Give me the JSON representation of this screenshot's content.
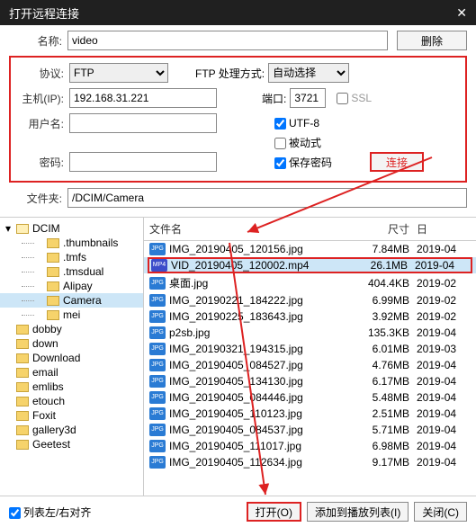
{
  "titlebar": {
    "title": "打开远程连接"
  },
  "form": {
    "name_label": "名称:",
    "name_value": "video",
    "delete_label": "删除",
    "protocol_label": "协议:",
    "protocol_value": "FTP",
    "mode_label": "FTP 处理方式:",
    "mode_value": "自动选择",
    "host_label": "主机(IP):",
    "host_value": "192.168.31.221",
    "port_label": "端口:",
    "port_value": "3721",
    "ssl_label": "SSL",
    "user_label": "用户名:",
    "user_value": "",
    "utf8_label": "UTF-8",
    "utf8_checked": true,
    "passive_label": "被动式",
    "passive_checked": false,
    "pass_label": "密码:",
    "pass_value": "",
    "savepw_label": "保存密码",
    "savepw_checked": true,
    "connect_label": "连接",
    "folder_label": "文件夹:",
    "folder_value": "/DCIM/Camera"
  },
  "tree": [
    {
      "label": "DCIM",
      "depth": 0,
      "open": true
    },
    {
      "label": ".thumbnails",
      "depth": 1
    },
    {
      "label": ".tmfs",
      "depth": 1
    },
    {
      "label": ".tmsdual",
      "depth": 1
    },
    {
      "label": "Alipay",
      "depth": 1
    },
    {
      "label": "Camera",
      "depth": 1,
      "selected": true
    },
    {
      "label": "mei",
      "depth": 1
    },
    {
      "label": "dobby",
      "depth": 0
    },
    {
      "label": "down",
      "depth": 0
    },
    {
      "label": "Download",
      "depth": 0
    },
    {
      "label": "email",
      "depth": 0
    },
    {
      "label": "emlibs",
      "depth": 0
    },
    {
      "label": "etouch",
      "depth": 0
    },
    {
      "label": "Foxit",
      "depth": 0
    },
    {
      "label": "gallery3d",
      "depth": 0
    },
    {
      "label": "Geetest",
      "depth": 0
    }
  ],
  "file_headers": {
    "name": "文件名",
    "size": "尺寸",
    "date": "日"
  },
  "files": [
    {
      "icon": "JPG",
      "name": "IMG_20190405_120156.jpg",
      "size": "7.84MB",
      "date": "2019-04"
    },
    {
      "icon": "MP4",
      "name": "VID_20190405_120002.mp4",
      "size": "26.1MB",
      "date": "2019-04",
      "selected": true,
      "boxed": true
    },
    {
      "icon": "JPG",
      "name": "桌面.jpg",
      "size": "404.4KB",
      "date": "2019-02"
    },
    {
      "icon": "JPG",
      "name": "IMG_20190221_184222.jpg",
      "size": "6.99MB",
      "date": "2019-02"
    },
    {
      "icon": "JPG",
      "name": "IMG_20190225_183643.jpg",
      "size": "3.92MB",
      "date": "2019-02"
    },
    {
      "icon": "JPG",
      "name": "p2sb.jpg",
      "size": "135.3KB",
      "date": "2019-04"
    },
    {
      "icon": "JPG",
      "name": "IMG_20190321_194315.jpg",
      "size": "6.01MB",
      "date": "2019-03"
    },
    {
      "icon": "JPG",
      "name": "IMG_20190405_084527.jpg",
      "size": "4.76MB",
      "date": "2019-04"
    },
    {
      "icon": "JPG",
      "name": "IMG_20190405_134130.jpg",
      "size": "6.17MB",
      "date": "2019-04"
    },
    {
      "icon": "JPG",
      "name": "IMG_20190405_084446.jpg",
      "size": "5.48MB",
      "date": "2019-04"
    },
    {
      "icon": "JPG",
      "name": "IMG_20190405_110123.jpg",
      "size": "2.51MB",
      "date": "2019-04"
    },
    {
      "icon": "JPG",
      "name": "IMG_20190405_084537.jpg",
      "size": "5.71MB",
      "date": "2019-04"
    },
    {
      "icon": "JPG",
      "name": "IMG_20190405_111017.jpg",
      "size": "6.98MB",
      "date": "2019-04"
    },
    {
      "icon": "JPG",
      "name": "IMG_20190405_112634.jpg",
      "size": "9.17MB",
      "date": "2019-04"
    }
  ],
  "footer": {
    "align_label": "列表左/右对齐",
    "open_label": "打开(O)",
    "addlist_label": "添加到播放列表(I)",
    "close_label": "关闭(C)"
  }
}
